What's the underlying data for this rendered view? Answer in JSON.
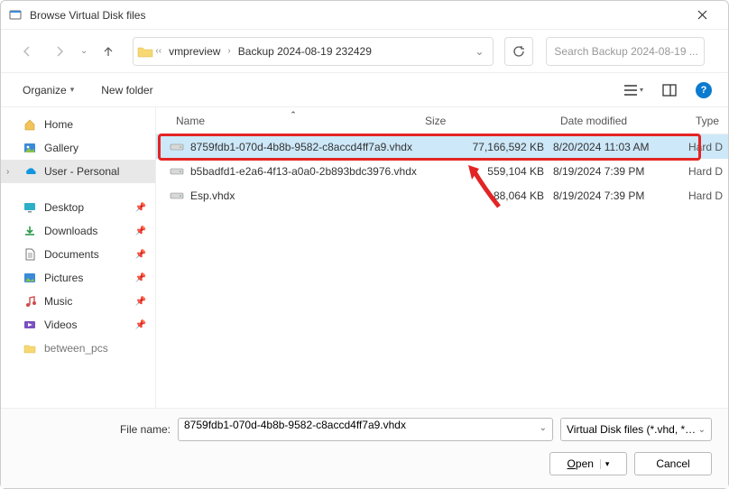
{
  "window": {
    "title": "Browse Virtual Disk files"
  },
  "breadcrumbs": {
    "a": "vmpreview",
    "b": "Backup 2024-08-19 232429"
  },
  "search": {
    "placeholder": "Search Backup 2024-08-19 ..."
  },
  "toolbar": {
    "organize": "Organize",
    "newfolder": "New folder"
  },
  "sidebar": {
    "home": "Home",
    "gallery": "Gallery",
    "user": "User - Personal",
    "desktop": "Desktop",
    "downloads": "Downloads",
    "documents": "Documents",
    "pictures": "Pictures",
    "music": "Music",
    "videos": "Videos",
    "between": "between_pcs"
  },
  "columns": {
    "name": "Name",
    "size": "Size",
    "date": "Date modified",
    "type": "Type"
  },
  "files": [
    {
      "name": "8759fdb1-070d-4b8b-9582-c8accd4ff7a9.vhdx",
      "size": "77,166,592 KB",
      "date": "8/20/2024 11:03 AM",
      "type": "Hard D"
    },
    {
      "name": "b5badfd1-e2a6-4f13-a0a0-2b893bdc3976.vhdx",
      "size": "559,104 KB",
      "date": "8/19/2024 7:39 PM",
      "type": "Hard D"
    },
    {
      "name": "Esp.vhdx",
      "size": "88,064 KB",
      "date": "8/19/2024 7:39 PM",
      "type": "Hard D"
    }
  ],
  "filename": {
    "label": "File name:",
    "value": "8759fdb1-070d-4b8b-9582-c8accd4ff7a9.vhdx"
  },
  "filter": {
    "label": "Virtual Disk files (*.vhd, *.vhdx)"
  },
  "buttons": {
    "open": "pen",
    "open_accel": "O",
    "cancel": "Cancel"
  }
}
